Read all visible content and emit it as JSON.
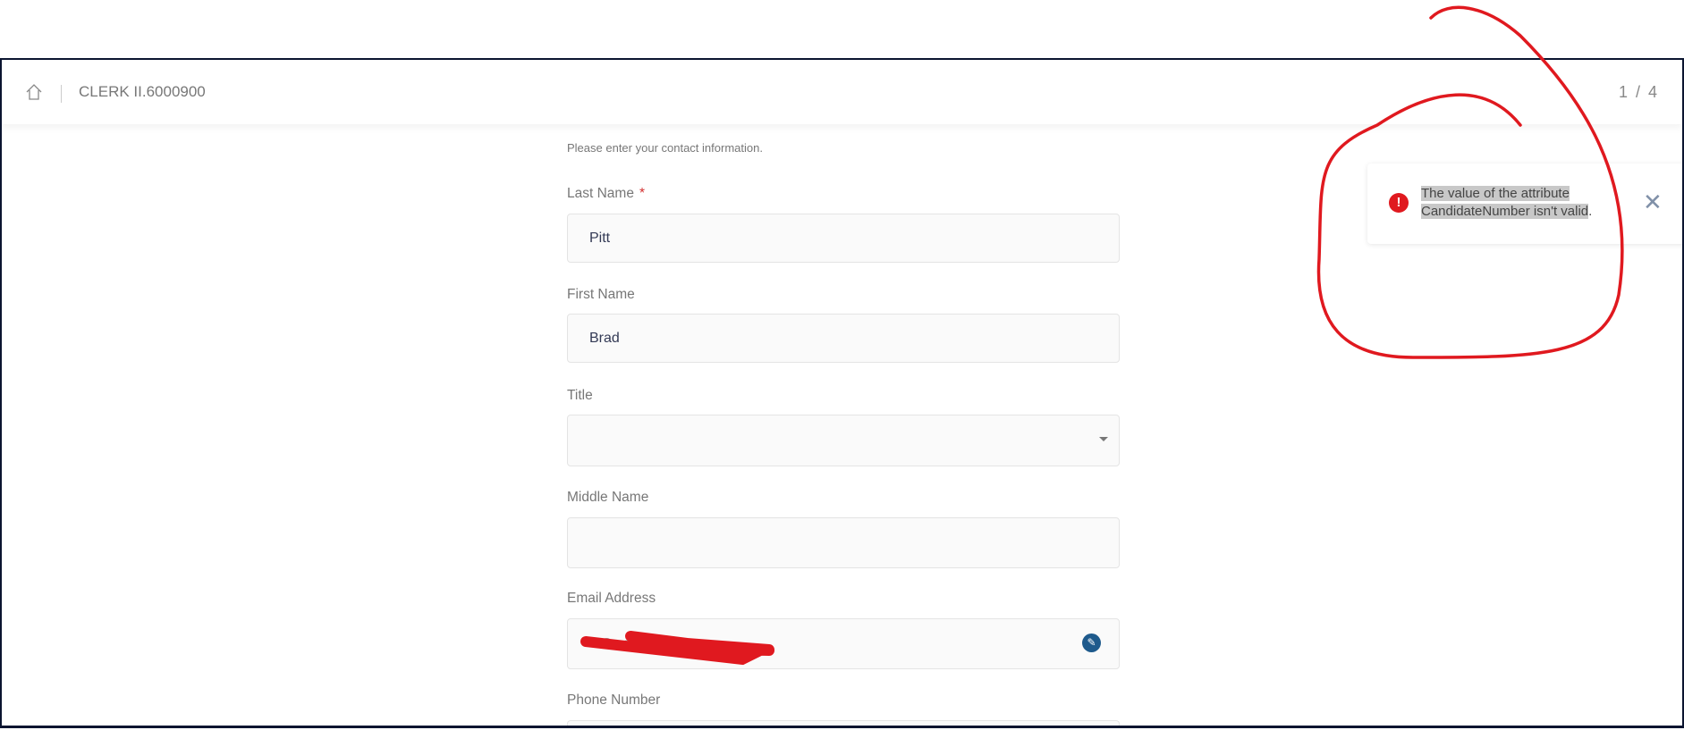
{
  "header": {
    "title": "CLERK II.6000900",
    "pager": "1 / 4"
  },
  "form": {
    "intro": "Please enter your contact information.",
    "last_name": {
      "label": "Last Name",
      "required": "*",
      "value": "Pitt"
    },
    "first_name": {
      "label": "First Name",
      "value": "Brad"
    },
    "title": {
      "label": "Title",
      "value": ""
    },
    "middle_name": {
      "label": "Middle Name",
      "value": ""
    },
    "email": {
      "label": "Email Address",
      "value": "...@...com"
    },
    "phone": {
      "label": "Phone Number",
      "value": ""
    }
  },
  "toast": {
    "line1": "The value of the attribute",
    "line2": "CandidateNumber isn't valid",
    "period": "."
  },
  "colors": {
    "error": "#e0191f",
    "edit": "#1e5a8c",
    "frame": "#0b1530"
  }
}
